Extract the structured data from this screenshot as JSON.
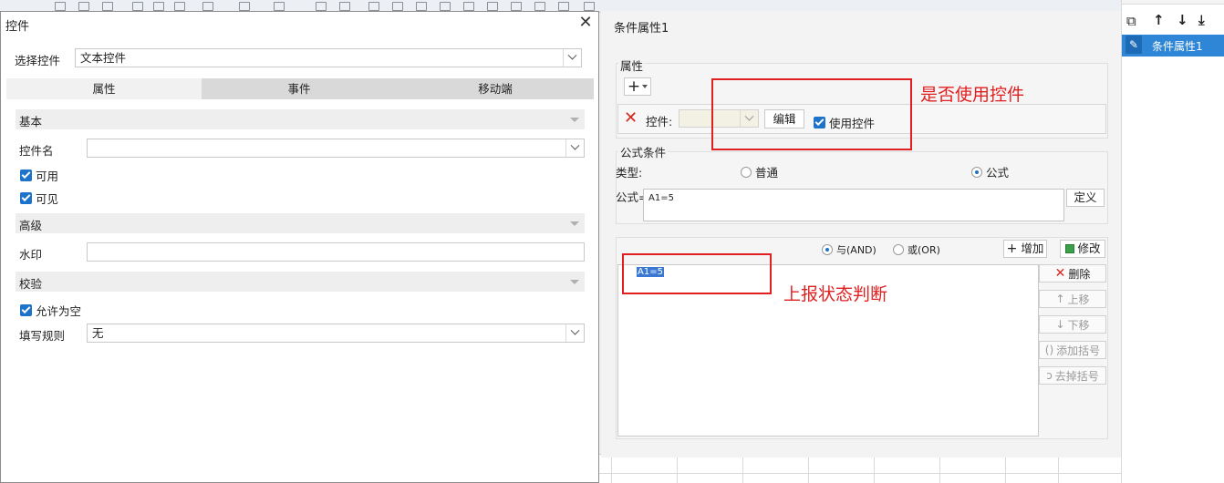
{
  "left_dialog": {
    "title": "控件",
    "select_control_label": "选择控件",
    "select_control_value": "文本控件",
    "tabs": [
      "属性",
      "事件",
      "移动端"
    ],
    "sections": {
      "basic": "基本",
      "advanced": "高级",
      "validation": "校验"
    },
    "control_name_label": "控件名",
    "control_name_value": "",
    "enabled_label": "可用",
    "visible_label": "可见",
    "watermark_label": "水印",
    "watermark_value": "",
    "allow_empty_label": "允许为空",
    "fill_rule_label": "填写规则",
    "fill_rule_value": "无"
  },
  "right_panel": {
    "title": "条件属性1",
    "attributes_label": "属性",
    "control_label": "控件:",
    "edit_label": "编辑",
    "use_control_label": "使用控件",
    "formula_condition_label": "公式条件",
    "type_label": "类型:",
    "type_normal": "普通",
    "type_formula": "公式",
    "formula_label": "公式=",
    "formula_value": "A1=5",
    "define_label": "定义",
    "and_label": "与(AND)",
    "or_label": "或(OR)",
    "add_label": "增加",
    "modify_label": "修改",
    "conditions": [
      "A1=5"
    ],
    "delete_label": "删除",
    "move_up_label": "上移",
    "move_down_label": "下移",
    "add_bracket_label": "添加括号",
    "remove_bracket_label": "去掉括号"
  },
  "far_right": {
    "list_items": [
      "条件属性1"
    ]
  },
  "annotations": {
    "use_control": "是否使用控件",
    "report_status": "上报状态判断"
  },
  "colors": {
    "accent": "#1c73c9",
    "annotation": "#e02020",
    "delete_red": "#d9261c"
  }
}
